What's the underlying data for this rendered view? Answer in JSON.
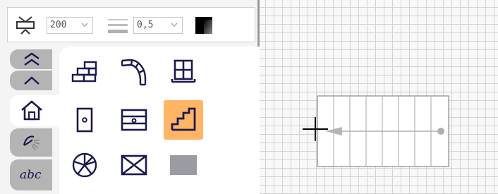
{
  "toolbar": {
    "width_value": "200",
    "thickness_value": "0,5",
    "color_swatch": [
      "#000000",
      "#9a9a9a"
    ]
  },
  "tabs": [
    {
      "name": "scroll-up-fast",
      "icon": "double-chevron-up-icon"
    },
    {
      "name": "scroll-up",
      "icon": "chevron-up-icon"
    },
    {
      "name": "house",
      "icon": "house-icon",
      "active": true
    },
    {
      "name": "lighting",
      "icon": "light-icon"
    },
    {
      "name": "text",
      "icon": "text-icon",
      "label": "abc"
    }
  ],
  "tools": [
    {
      "name": "brick-wall",
      "icon": "brick-wall-icon"
    },
    {
      "name": "curved-wall",
      "icon": "curved-wall-icon"
    },
    {
      "name": "window",
      "icon": "window-icon"
    },
    {
      "name": "door",
      "icon": "door-icon"
    },
    {
      "name": "cabinet",
      "icon": "cabinet-icon"
    },
    {
      "name": "stairs",
      "icon": "stairs-icon",
      "selected": true
    },
    {
      "name": "spiral-stairs",
      "icon": "spiral-stairs-icon"
    },
    {
      "name": "box",
      "icon": "crossed-box-icon"
    },
    {
      "name": "gray-block",
      "icon": "gray-block-icon"
    }
  ],
  "colors": {
    "accent": "#ffb466",
    "icon_stroke": "#1a1a4e",
    "grid": "#d2d2d2",
    "tab_inactive": "#b4b4b4"
  }
}
